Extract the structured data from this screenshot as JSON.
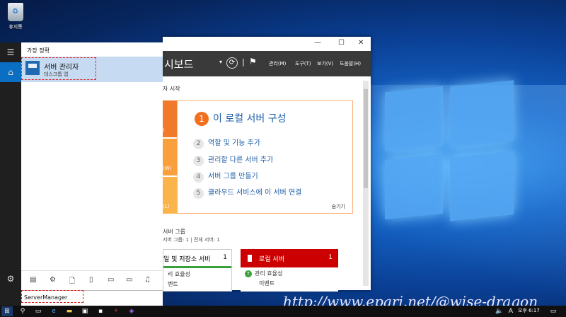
{
  "desktop": {
    "recycle_bin_label": "휴지통"
  },
  "start_menu": {
    "section_header": "가장 정확",
    "best_match": {
      "title": "서버 관리자",
      "subtitle": "데스크톱 앱"
    },
    "search_query": "ServerManager"
  },
  "server_manager": {
    "header_title": "시보드",
    "menu": [
      "관리(M)",
      "도구(T)",
      "보기(V)",
      "도움말(H)"
    ],
    "start_label": "자 시작",
    "side_labels": [
      "",
      ")",
      "(W)",
      "(L)"
    ],
    "quick_start": [
      {
        "num": "1",
        "label": "이 로컬 서버 구성"
      },
      {
        "num": "2",
        "label": "역할 및 기능 추가"
      },
      {
        "num": "3",
        "label": "관리할 다른 서버 추가"
      },
      {
        "num": "4",
        "label": "서버 그룹 만들기"
      },
      {
        "num": "5",
        "label": "클라우드 서비스에 이 서버 연결"
      }
    ],
    "hide_label": "숨기기",
    "groups_title": "서버 그룹",
    "groups_counts": "서버 그룹: 1  |  전체 서버: 1",
    "tile_file": {
      "title": "일 및 저장소 서비",
      "count": "1",
      "row1": "리 효율성",
      "row2": "벤트"
    },
    "tile_local": {
      "title": "로컬 서버",
      "count": "1",
      "row1": "관리 효율성",
      "row2": "이벤트"
    }
  },
  "taskbar": {
    "clock": "오후 6:17",
    "lang": "A"
  },
  "watermark": "http://www.epari.net/@wise-dragon"
}
